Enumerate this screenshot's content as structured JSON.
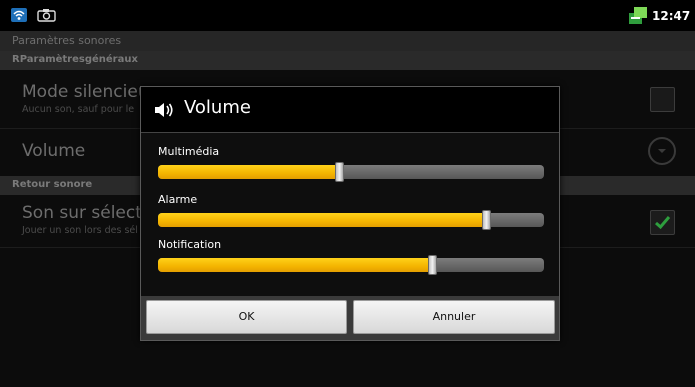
{
  "status_bar": {
    "time": "12:47",
    "icons": [
      "wifi-icon",
      "camera-icon",
      "sync-icon"
    ]
  },
  "settings": {
    "screen_title": "Paramètres sonores",
    "section_general": "RParamètresgénéraux",
    "silent_mode": {
      "title": "Mode silencieu",
      "summary": "Aucun son, sauf pour le",
      "checked": false
    },
    "volume": {
      "title": "Volume"
    },
    "section_feedback": "Retour sonore",
    "touch_sound": {
      "title": "Son sur sélectio",
      "summary": "Jouer un son lors des sél",
      "checked": true
    }
  },
  "dialog": {
    "title": "Volume",
    "icon": "speaker-icon",
    "sliders": [
      {
        "label": "Multimédia",
        "value_percent": 47
      },
      {
        "label": "Alarme",
        "value_percent": 85
      },
      {
        "label": "Notification",
        "value_percent": 71
      }
    ],
    "ok_label": "OK",
    "cancel_label": "Annuler"
  },
  "colors": {
    "slider_fill": "#f4b400",
    "check_green": "#2e9e3e"
  }
}
